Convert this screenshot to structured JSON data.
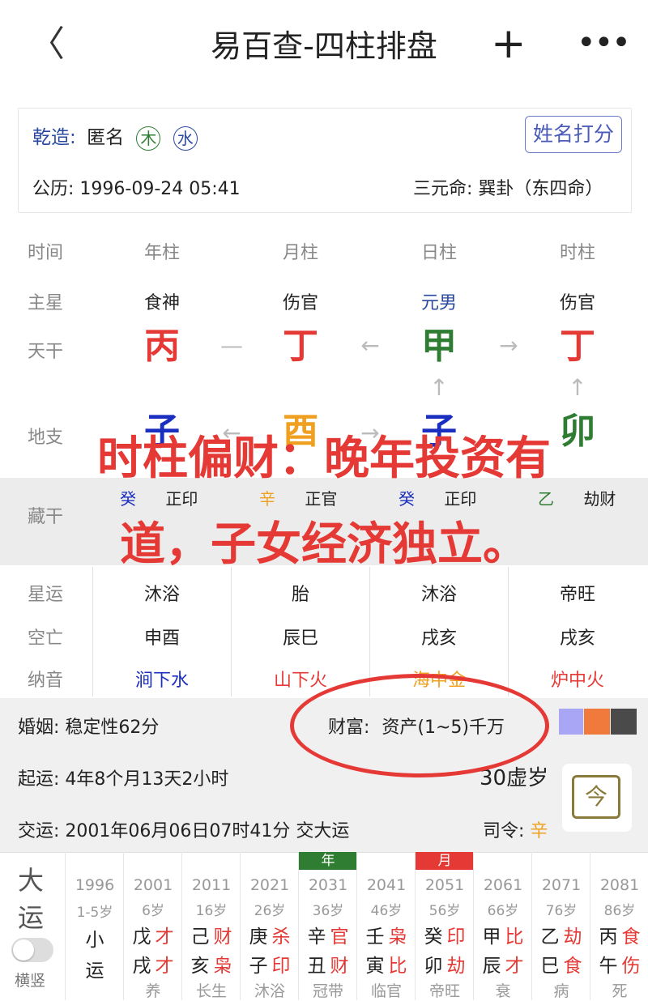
{
  "header": {
    "back": "〈",
    "title": "易百查-四柱排盘",
    "plus": "+",
    "more": "•••"
  },
  "info": {
    "gender_label": "乾造:",
    "name": "匿名",
    "element1": "木",
    "element2": "水",
    "name_score_button": "姓名打分",
    "solar_label": "公历:",
    "solar_date": "1996-09-24 05:41",
    "sanyuan_label": "三元命:",
    "sanyuan_value": "巽卦（东四命）"
  },
  "grid": {
    "row_labels": {
      "time": "时间",
      "main_star": "主星",
      "tiangan": "天干",
      "dizhi": "地支",
      "canggan": "藏干",
      "xingyun": "星运",
      "kongwang": "空亡",
      "nayin": "纳音"
    },
    "columns": [
      "年柱",
      "月柱",
      "日柱",
      "时柱"
    ],
    "main_stars": [
      "食神",
      "伤官",
      "元男",
      "伤官"
    ],
    "tiangan": [
      "丙",
      "丁",
      "甲",
      "丁"
    ],
    "dizhi": [
      "子",
      "酉",
      "子",
      "卯"
    ],
    "canggan": [
      {
        "gan": "癸",
        "shen": "正印"
      },
      {
        "gan": "辛",
        "shen": "正官"
      },
      {
        "gan": "癸",
        "shen": "正印"
      },
      {
        "gan": "乙",
        "shen": "劫财"
      }
    ],
    "xingyun": [
      "沐浴",
      "胎",
      "沐浴",
      "帝旺"
    ],
    "kongwang": [
      "申酉",
      "辰巳",
      "戌亥",
      "戌亥"
    ],
    "nayin": [
      "涧下水",
      "山下火",
      "海中金",
      "炉中火"
    ],
    "colors": {
      "fire": "#e53935",
      "wood": "#2e7d32",
      "water": "#1a2fbf",
      "metal": "#f0a020",
      "blue": "#2a4aa0"
    }
  },
  "overlay": {
    "line1": "时柱偏财：晚年投资有",
    "line2": "道，子女经济独立。"
  },
  "details": {
    "marriage_label": "婚姻:",
    "marriage_value": "稳定性62分",
    "wealth_label": "财富:",
    "wealth_value": "资产(1~5)千万",
    "qiyun_label": "起运:",
    "qiyun_value": "4年8个月13天2小时",
    "age": "30虚岁",
    "jiaoyun_label": "交运:",
    "jiaoyun_value": "2001年06月06日07时41分 交大运",
    "siling_label": "司令:",
    "siling_value": "辛",
    "today_icon": "今",
    "swatches": [
      "#a9a6f5",
      "#f07a3c",
      "#4a4a4a"
    ]
  },
  "dayun": {
    "label1": "大",
    "label2": "运",
    "toggle_label": "横竖",
    "small": {
      "year": "1996",
      "age": "1-5岁",
      "l1": "小",
      "l2": "运"
    },
    "columns": [
      {
        "year": "2001",
        "age": "6岁",
        "g": "戊",
        "gs": "才",
        "z": "戌",
        "zs": "才",
        "stage": "养",
        "badge": ""
      },
      {
        "year": "2011",
        "age": "16岁",
        "g": "己",
        "gs": "财",
        "z": "亥",
        "zs": "枭",
        "stage": "长生",
        "badge": ""
      },
      {
        "year": "2021",
        "age": "26岁",
        "g": "庚",
        "gs": "杀",
        "z": "子",
        "zs": "印",
        "stage": "沐浴",
        "badge": ""
      },
      {
        "year": "2031",
        "age": "36岁",
        "g": "辛",
        "gs": "官",
        "z": "丑",
        "zs": "财",
        "stage": "冠带",
        "badge": "年"
      },
      {
        "year": "2041",
        "age": "46岁",
        "g": "壬",
        "gs": "枭",
        "z": "寅",
        "zs": "比",
        "stage": "临官",
        "badge": ""
      },
      {
        "year": "2051",
        "age": "56岁",
        "g": "癸",
        "gs": "印",
        "z": "卯",
        "zs": "劫",
        "stage": "帝旺",
        "badge": "月"
      },
      {
        "year": "2061",
        "age": "66岁",
        "g": "甲",
        "gs": "比",
        "z": "辰",
        "zs": "才",
        "stage": "衰",
        "badge": ""
      },
      {
        "year": "2071",
        "age": "76岁",
        "g": "乙",
        "gs": "劫",
        "z": "巳",
        "zs": "食",
        "stage": "病",
        "badge": ""
      },
      {
        "year": "2081",
        "age": "86岁",
        "g": "丙",
        "gs": "食",
        "z": "午",
        "zs": "伤",
        "stage": "死",
        "badge": ""
      }
    ]
  }
}
